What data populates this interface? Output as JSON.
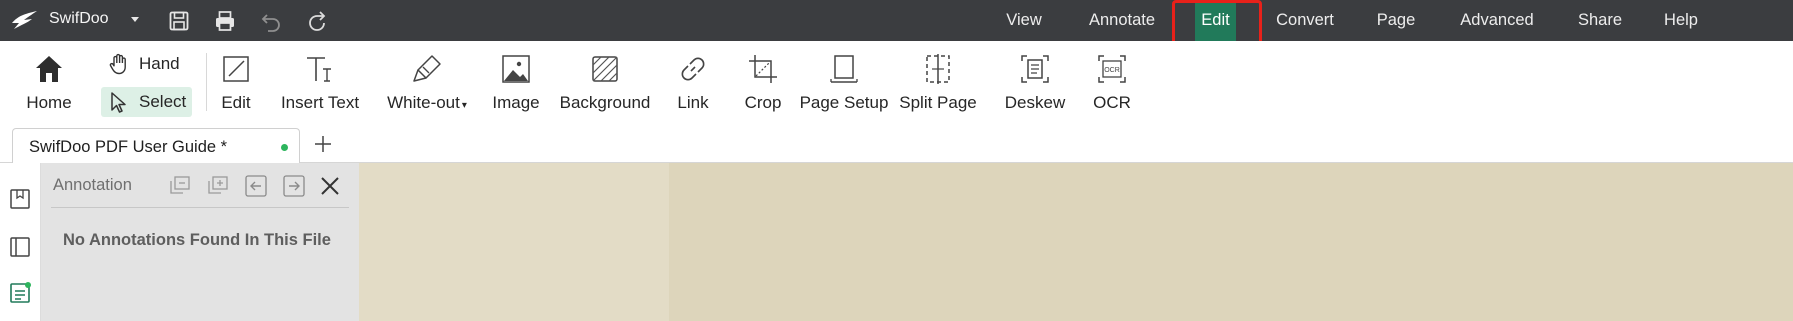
{
  "titlebar": {
    "app_name": "SwifDoo",
    "icons": [
      "swifdoo-logo-icon",
      "dropdown-icon",
      "save-icon",
      "print-icon",
      "undo-icon",
      "redo-icon"
    ],
    "menus": [
      {
        "label": "View"
      },
      {
        "label": "Annotate"
      },
      {
        "label": "Edit",
        "active": true
      },
      {
        "label": "Convert"
      },
      {
        "label": "Page"
      },
      {
        "label": "Advanced"
      },
      {
        "label": "Share"
      },
      {
        "label": "Help"
      }
    ],
    "colors": {
      "background": "#3b3d40",
      "active_menu": "#217a5a",
      "callout": "#e8211a"
    }
  },
  "ribbon": {
    "home": "Home",
    "hand": "Hand",
    "select": "Select",
    "tools": [
      {
        "label": "Edit",
        "icon": "edit-icon"
      },
      {
        "label": "Insert Text",
        "icon": "insert-text-icon"
      },
      {
        "label": "White-out",
        "icon": "white-out-icon",
        "has_dropdown": true
      },
      {
        "label": "Image",
        "icon": "image-icon"
      },
      {
        "label": "Background",
        "icon": "background-icon"
      },
      {
        "label": "Link",
        "icon": "link-icon"
      },
      {
        "label": "Crop",
        "icon": "crop-icon"
      },
      {
        "label": "Page Setup",
        "icon": "page-setup-icon"
      },
      {
        "label": "Split Page",
        "icon": "split-page-icon"
      },
      {
        "label": "Deskew",
        "icon": "deskew-icon"
      },
      {
        "label": "OCR",
        "icon": "ocr-icon"
      }
    ]
  },
  "tabs": {
    "document": "SwifDoo PDF User Guide *",
    "unsaved_dot_color": "#2db55d"
  },
  "sidebar": {
    "icons": [
      "bookmark-icon",
      "thumbnails-icon",
      "annotations-icon"
    ]
  },
  "annotation_panel": {
    "title": "Annotation",
    "empty_message": "No Annotations Found In This File",
    "icons": [
      "collapse-all-icon",
      "expand-all-icon",
      "previous-annotation-icon",
      "next-annotation-icon",
      "close-icon"
    ]
  }
}
